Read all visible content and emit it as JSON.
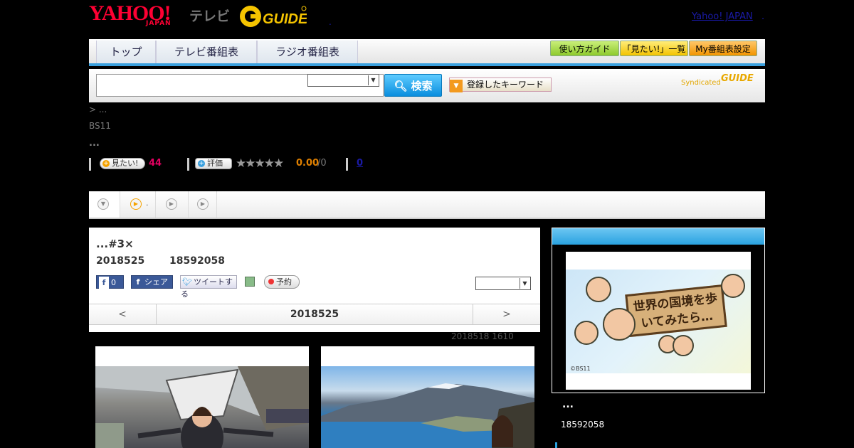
{
  "header": {
    "logo_yahoo": "YAHOO!",
    "logo_japan": "JAPAN",
    "logo_tv": "テレビ",
    "logo_gguide": "G GUIDE",
    "dot": ".",
    "yahoo_japan_link": "Yahoo! JAPAN",
    "link_dot": "."
  },
  "nav": {
    "tabs": [
      "トップ",
      "テレビ番組表",
      "ラジオ番組表"
    ],
    "buttons": [
      "使い方ガイド",
      "「見たい!」一覧",
      "My番組表設定"
    ]
  },
  "search": {
    "input_value": "",
    "select_value": "",
    "button_label": "検索",
    "keyword_button": "登録したキーワード",
    "syndicated": "Syndicated",
    "gguide": "GUIDE"
  },
  "program": {
    "breadcrumb": "> ...",
    "channel": "BS11",
    "dots": "...",
    "want_label": "見たい!",
    "want_count": "44",
    "rate_label": "評価",
    "stars": "★★★★★",
    "rating": "0.00",
    "rating_of": "/0",
    "comments": "0"
  },
  "tabs": {
    "items": [
      "",
      ".",
      "",
      ""
    ]
  },
  "episode": {
    "title": "...#3×",
    "date": "2018525",
    "time": "18592058",
    "fb_count": "0",
    "fb_share": "シェア",
    "tweet": "ツイートする",
    "reserve": "予約",
    "select_value": "",
    "pager_prev": "<",
    "pager_current": "2018525",
    "pager_next": ">",
    "updated": "2018518  1610"
  },
  "side": {
    "board_text": "世界の国境を歩いてみたら…",
    "copyright": "©BS11",
    "dots": "...",
    "time": "18592058"
  },
  "colors": {
    "accent_blue": "#2aa2e0",
    "want_pink": "#e40061",
    "rating_orange": "#e08000",
    "yahoo_red": "#ff0033"
  }
}
